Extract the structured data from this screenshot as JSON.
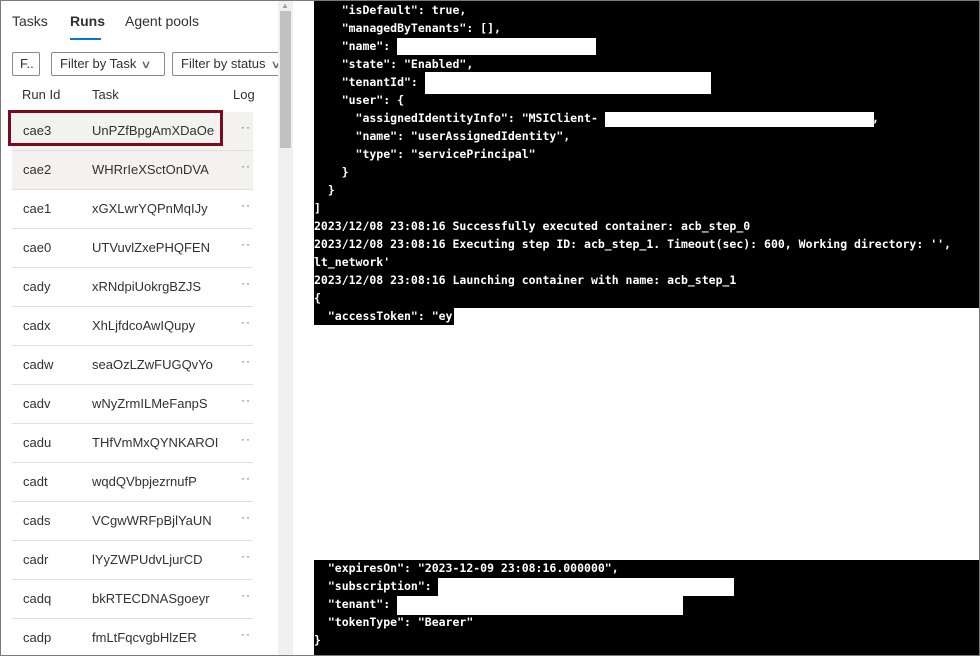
{
  "tabs": [
    {
      "label": "Tasks",
      "active": false
    },
    {
      "label": "Runs",
      "active": true
    },
    {
      "label": "Agent pools",
      "active": false
    }
  ],
  "filters": {
    "filter_short": "F..",
    "filter_task": "Filter by Task",
    "filter_status": "Filter by status"
  },
  "columns": {
    "run_id": "Run Id",
    "task": "Task",
    "log": "Log"
  },
  "runs": [
    {
      "run_id": "cae3",
      "task": "UnPZfBpgAmXDaOe",
      "more": "··",
      "selected": true
    },
    {
      "run_id": "cae2",
      "task": "WHRrIeXSctOnDVA",
      "more": "··"
    },
    {
      "run_id": "cae1",
      "task": "xGXLwrYQPnMqIJy",
      "more": "··"
    },
    {
      "run_id": "cae0",
      "task": "UTVuvlZxePHQFEN",
      "more": "··"
    },
    {
      "run_id": "cady",
      "task": "xRNdpiUokrgBZJS",
      "more": "··"
    },
    {
      "run_id": "cadx",
      "task": "XhLjfdcoAwIQupy",
      "more": "··"
    },
    {
      "run_id": "cadw",
      "task": "seaOzLZwFUGQvYo",
      "more": "··"
    },
    {
      "run_id": "cadv",
      "task": "wNyZrmILMeFanpS",
      "more": "··"
    },
    {
      "run_id": "cadu",
      "task": "THfVmMxQYNKAROI",
      "more": "··"
    },
    {
      "run_id": "cadt",
      "task": "wqdQVbpjezrnufP",
      "more": "··"
    },
    {
      "run_id": "cads",
      "task": "VCgwWRFpBjlYaUN",
      "more": "··"
    },
    {
      "run_id": "cadr",
      "task": "lYyZWPUdvLjurCD",
      "more": "··"
    },
    {
      "run_id": "cadq",
      "task": "bkRTECDNASgoeyr",
      "more": "··"
    },
    {
      "run_id": "cadp",
      "task": "fmLtFqcvgbHlzER",
      "more": "··"
    }
  ],
  "icons": {
    "chevron": "∨",
    "scroll_up": "▲"
  },
  "log_lines": [
    "    \"isDefault\": true,",
    "    \"managedByTenants\": [],",
    "    \"name\": ",
    "    \"state\": \"Enabled\",",
    "    \"tenantId\": ",
    "    \"user\": {",
    "      \"assignedIdentityInfo\": \"MSIClient-",
    "      \"name\": \"userAssignedIdentity\",",
    "      \"type\": \"servicePrincipal\"",
    "    }",
    "  }",
    "]",
    "2023/12/08 23:08:16 Successfully executed container: acb_step_0",
    "2023/12/08 23:08:16 Executing step ID: acb_step_1. Timeout(sec): 600, Working directory: '',",
    "lt_network'",
    "2023/12/08 23:08:16 Launching container with name: acb_step_1",
    "{",
    "  \"accessToken\": \"ey",
    "  \"expiresOn\": \"2023-12-09 23:08:16.000000\",",
    "  \"subscription\": ",
    "  \"tenant\": ",
    "  \"tokenType\": \"Bearer\"",
    "}"
  ],
  "log_trailing_comma": ","
}
